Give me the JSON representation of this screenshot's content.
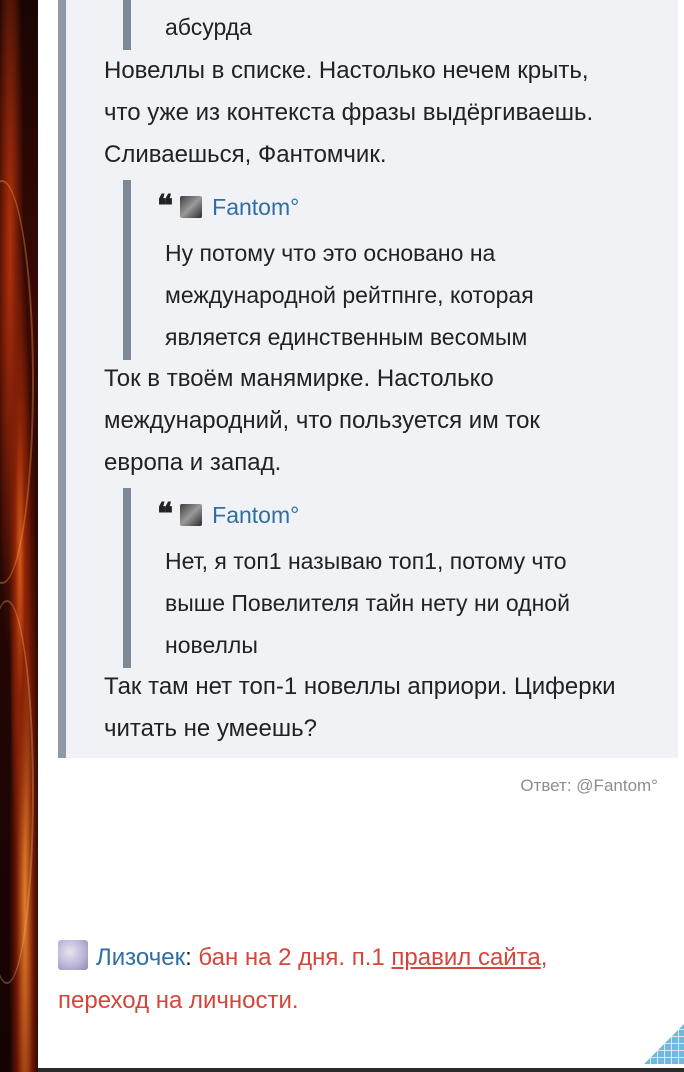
{
  "post": {
    "top_quote_tail": "абсурда",
    "paragraph1": [
      "Новеллы в списке. Настолько нечем крыть,",
      "что уже из контекста фразы выдёргиваешь.",
      "Сливаешься, Фантомчик."
    ],
    "quote2": {
      "author": "Fantom°",
      "lines": [
        "Ну потому что это основано на",
        "международной рейтпнге, которая",
        "является единственным весомым"
      ]
    },
    "paragraph2": [
      "Ток в твоём манямирке. Настолько",
      "международний, что пользуется им ток",
      "европа и запад."
    ],
    "quote3": {
      "author": "Fantom°",
      "lines": [
        "Нет, я топ1 называю топ1, потому что",
        "выше Повелителя тайн нету ни одной",
        "новеллы"
      ]
    },
    "paragraph3": [
      "Так там нет топ-1 новеллы априори. Циферки",
      "читать не умеешь?"
    ]
  },
  "reply": {
    "label": "Ответ:",
    "to": "@Fantom°"
  },
  "moderation": {
    "moderator": "Лизочек",
    "separator": ":",
    "text_before": " бан на 2 дня. п.1 ",
    "link": "правил сайта",
    "text_after": ",",
    "line2": "переход на личности."
  }
}
